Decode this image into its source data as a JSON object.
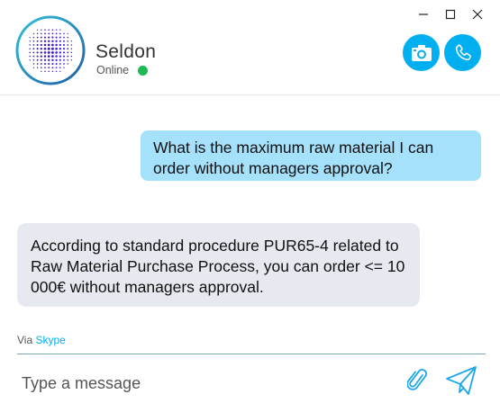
{
  "window": {
    "minimize_icon": "minimize-icon",
    "maximize_icon": "maximize-icon",
    "close_icon": "close-icon"
  },
  "header": {
    "name": "Seldon",
    "status": "Online",
    "status_color": "#1db954",
    "accent": "#00aff0"
  },
  "buttons": {
    "video_icon": "camera-icon",
    "call_icon": "phone-icon"
  },
  "messages": [
    {
      "direction": "outgoing",
      "text": "What is the maximum raw material I can order without managers approval?"
    },
    {
      "direction": "incoming",
      "text": "According to standard procedure PUR65-4 related to Raw Material Purchase Process, you can order <= 10 000€ without managers approval."
    }
  ],
  "footer": {
    "via_label": "Via",
    "via_link": "Skype",
    "placeholder": "Type a message",
    "attach_icon": "paperclip-icon",
    "send_icon": "send-icon"
  }
}
